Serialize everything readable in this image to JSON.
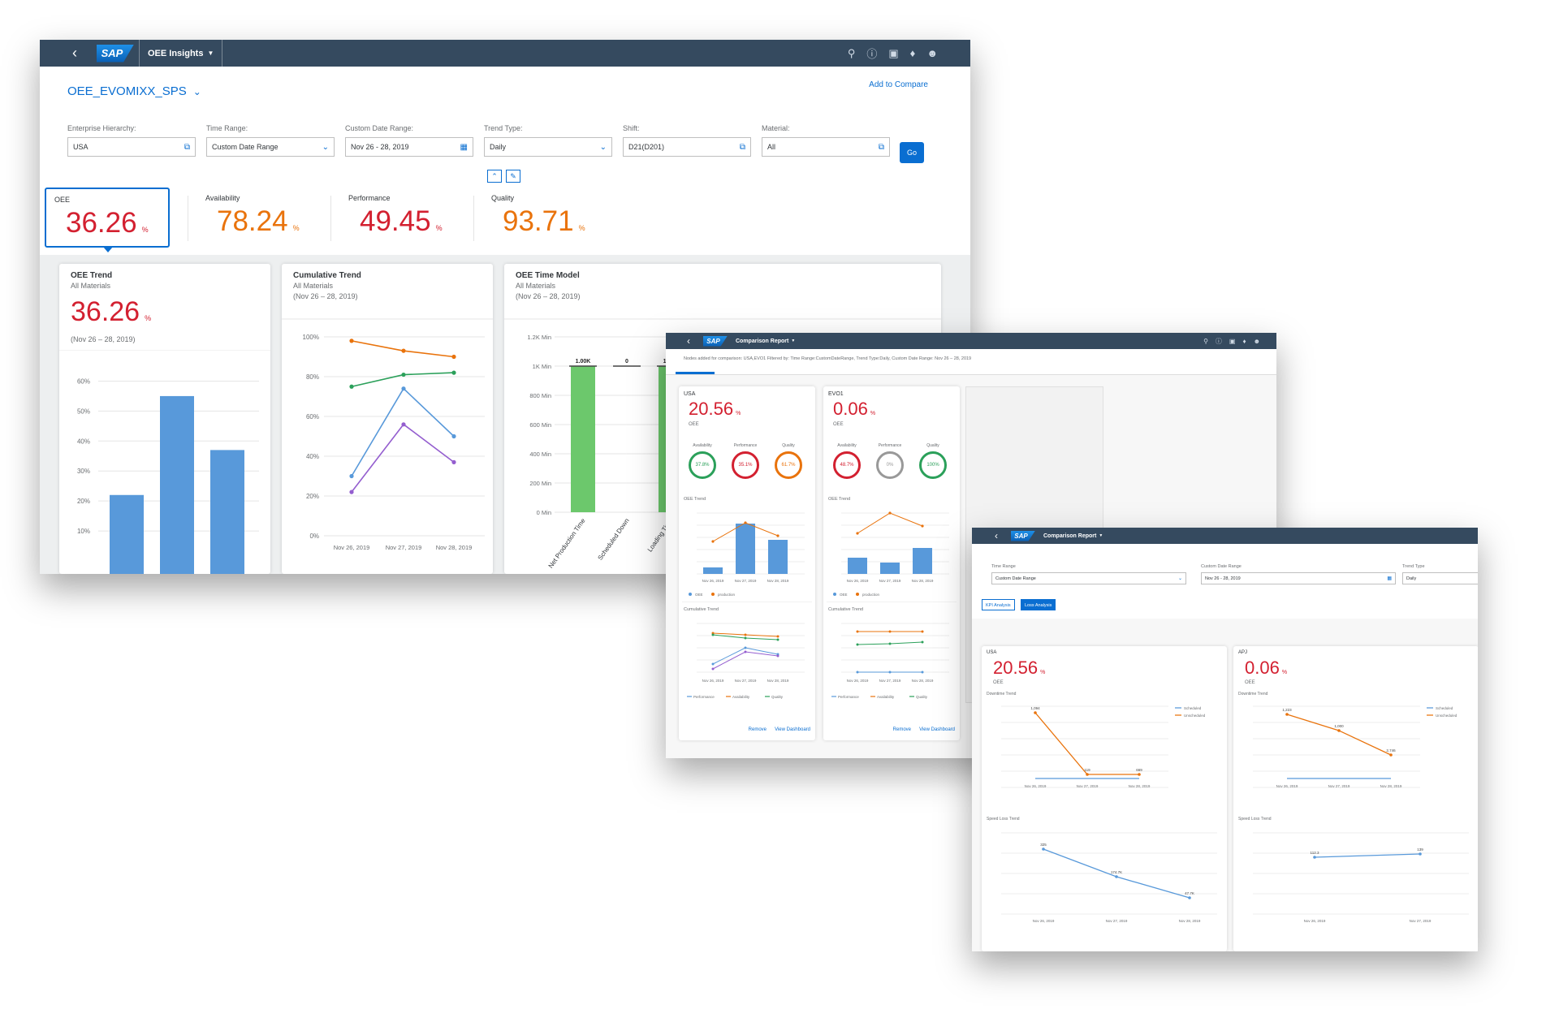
{
  "main": {
    "shell_title": "OEE Insights",
    "page_title": "OEE_EVOMIXX_SPS",
    "add_to_compare": "Add to Compare",
    "filters": [
      {
        "label": "Enterprise Hierarchy:",
        "value": "USA",
        "icon": "value-help-icon"
      },
      {
        "label": "Time Range:",
        "value": "Custom Date Range",
        "icon": "chevron-down-icon"
      },
      {
        "label": "Custom Date Range:",
        "value": "Nov 26 - 28, 2019",
        "icon": "calendar-icon"
      },
      {
        "label": "Trend Type:",
        "value": "Daily",
        "icon": "chevron-down-icon"
      },
      {
        "label": "Shift:",
        "value": "D21(D201)",
        "icon": "value-help-icon"
      },
      {
        "label": "Material:",
        "value": "All",
        "icon": "value-help-icon"
      }
    ],
    "go_label": "Go",
    "kpis": [
      {
        "label": "OEE",
        "value": "36.26",
        "unit": "%"
      },
      {
        "label": "Availability",
        "value": "78.24",
        "unit": "%"
      },
      {
        "label": "Performance",
        "value": "49.45",
        "unit": "%"
      },
      {
        "label": "Quality",
        "value": "93.71",
        "unit": "%"
      }
    ],
    "oee_trend": {
      "title": "OEE Trend",
      "subtitle": "All Materials",
      "value": "36.26",
      "unit": "%",
      "range": "(Nov 26 – 28, 2019)"
    },
    "cumulative": {
      "title": "Cumulative Trend",
      "subtitle": "All Materials",
      "range": "(Nov 26 – 28, 2019)"
    },
    "time_model": {
      "title": "OEE Time Model",
      "subtitle": "All Materials",
      "range": "(Nov 26 – 28, 2019)"
    }
  },
  "comp1": {
    "shell_title": "Comparison Report",
    "info": "Nodes added for comparison: USA,EVO1 Filtered by: Time Range:CustomDateRange, Trend Type:Daily, Custom Date Range: Nov 26 – 28, 2019",
    "cards": [
      {
        "name": "USA",
        "value": "20.56",
        "unit": "%",
        "sub": "OEE",
        "oee_trend_title": "OEE Trend",
        "cumulative_title": "Cumulative Trend",
        "gauges": [
          {
            "label": "Availability",
            "value": "37.8%"
          },
          {
            "label": "Performance",
            "value": "35.1%"
          },
          {
            "label": "Quality",
            "value": "61.7%"
          }
        ],
        "remove": "Remove",
        "view": "View Dashboard"
      },
      {
        "name": "EVO1",
        "value": "0.06",
        "unit": "%",
        "sub": "OEE",
        "oee_trend_title": "OEE Trend",
        "cumulative_title": "Cumulative Trend",
        "gauges": [
          {
            "label": "Availability",
            "value": "48.7%"
          },
          {
            "label": "Performance",
            "value": "0%"
          },
          {
            "label": "Quality",
            "value": "100%"
          }
        ],
        "remove": "Remove",
        "view": "View Dashboard"
      }
    ],
    "legend_a": [
      "OEE",
      "production"
    ],
    "legend_b": [
      "Performance",
      "Availability",
      "Quality"
    ],
    "dates": [
      "Nov 26, 2019",
      "Nov 27, 2019",
      "Nov 28, 2019"
    ]
  },
  "comp2": {
    "shell_title": "Comparison Report",
    "filters": [
      {
        "label": "Time Range",
        "value": "Custom Date Range",
        "icon": "chevron-down-icon"
      },
      {
        "label": "Custom Date Range",
        "value": "Nov 26 - 28, 2019",
        "icon": "calendar-icon"
      },
      {
        "label": "Trend Type",
        "value": "Daily",
        "icon": ""
      }
    ],
    "tabs": [
      "KPI Analysis",
      "Loss Analysis"
    ],
    "cards": [
      {
        "name": "USA",
        "value": "20.56",
        "unit": "%",
        "sub": "OEE",
        "t1": "Downtime Trend",
        "t2": "Speed Loss Trend",
        "dt_labels": [
          "1,094",
          "119",
          "669"
        ],
        "sl_labels": [
          "325",
          "174.7K",
          "47.7K"
        ]
      },
      {
        "name": "APJ",
        "value": "0.06",
        "unit": "%",
        "sub": "OEE",
        "t1": "Downtime Trend",
        "t2": "Speed Loss Trend",
        "dt_labels": [
          "1,223",
          "1,000",
          "2,746"
        ],
        "sl_labels": [
          "112.3",
          "139"
        ]
      }
    ],
    "legend": [
      "Scheduled",
      "Unscheduled"
    ],
    "dates": [
      "Nov 26, 2019",
      "Nov 27, 2019",
      "Nov 28, 2019"
    ]
  },
  "colors": {
    "shell": "#354a5f",
    "accent": "#0a6ed1",
    "red": "#d32030",
    "orange": "#e9730c",
    "bar_blue": "#5899da",
    "green_bar": "#6cc86c"
  },
  "chart_data": [
    {
      "type": "bar",
      "title": "OEE Trend",
      "y_ticks": [
        "60%",
        "50%",
        "40%",
        "30%",
        "20%",
        "10%"
      ],
      "ylim": [
        0,
        65
      ],
      "values": [
        22,
        55,
        37
      ]
    },
    {
      "type": "line",
      "title": "Cumulative Trend",
      "y_ticks": [
        "100%",
        "80%",
        "60%",
        "40%",
        "20%",
        "0%"
      ],
      "ylim": [
        0,
        100
      ],
      "categories": [
        "Nov 26, 2019",
        "Nov 27, 2019",
        "Nov 28, 2019"
      ],
      "series": [
        {
          "values": [
            98,
            93,
            90
          ]
        },
        {
          "values": [
            75,
            81,
            82
          ]
        },
        {
          "values": [
            30,
            74,
            50
          ]
        },
        {
          "values": [
            22,
            56,
            37
          ]
        }
      ]
    },
    {
      "type": "bar",
      "title": "OEE Time Model",
      "y_ticks": [
        "1.2K Min",
        "1K Min",
        "800 Min",
        "600 Min",
        "400 Min",
        "200 Min",
        "0 Min"
      ],
      "ylim": [
        0,
        1200
      ],
      "categories": [
        "Net Production Time",
        "Scheduled Down",
        "Loading Time",
        ""
      ],
      "bar_labels": [
        "1.00K",
        "0",
        "1.00K"
      ],
      "values": [
        1000,
        0,
        1000
      ]
    }
  ]
}
